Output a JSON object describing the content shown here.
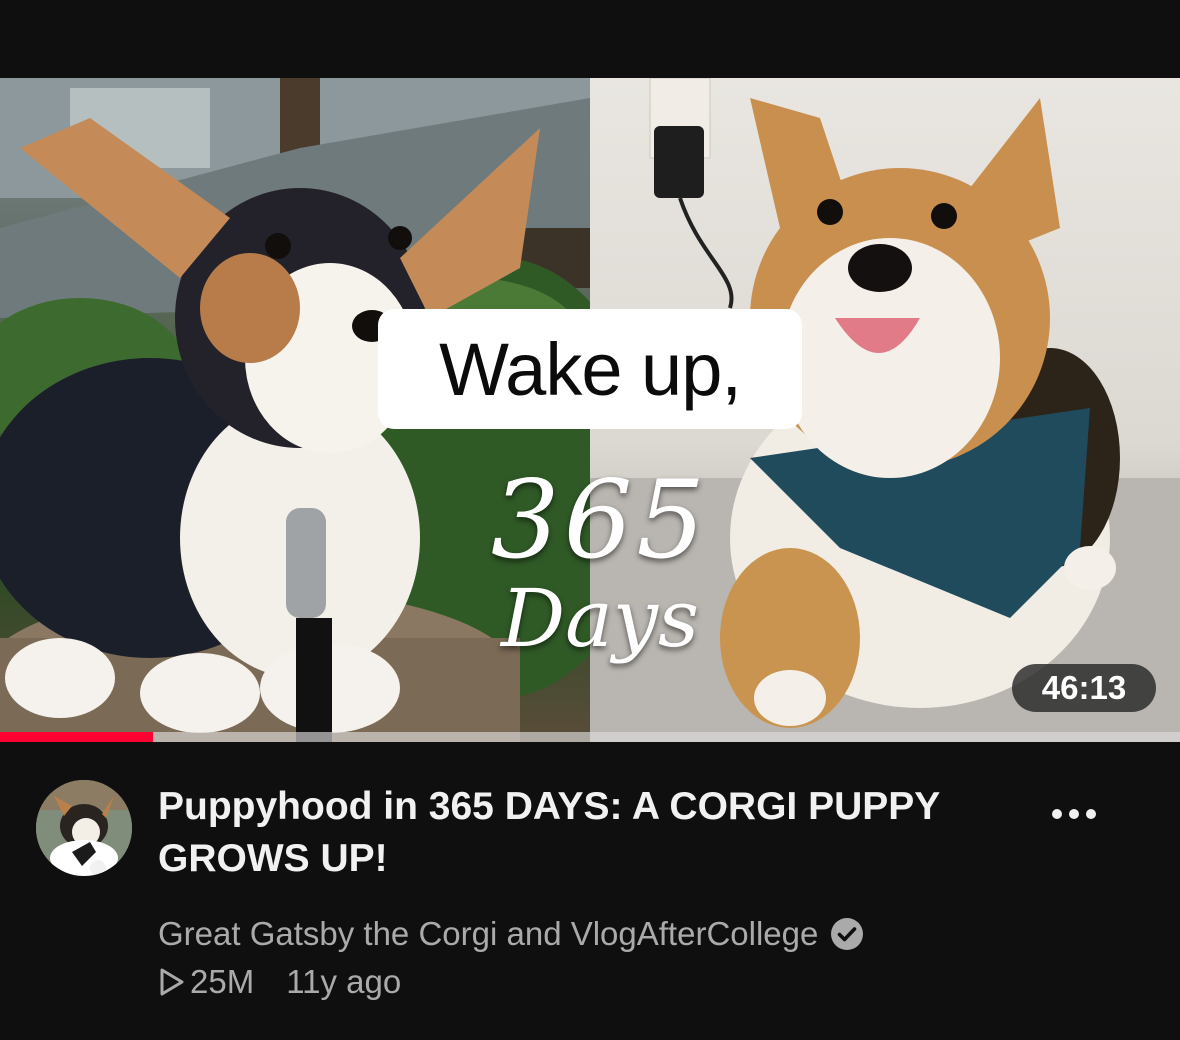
{
  "thumbnail": {
    "caption": "Wake up,",
    "overlay_number": "365",
    "overlay_word": "Days",
    "duration": "46:13",
    "watch_progress": 0.13
  },
  "video": {
    "title": "Puppyhood in 365 DAYS: A CORGI PUPPY GROWS UP!",
    "channel": "Great Gatsby the Corgi and VlogAfterCollege",
    "views": "25M",
    "age": "11y ago"
  },
  "icons": {
    "avatar": "corgi-avatar",
    "verified": "verified-check-icon",
    "views": "play-outline-icon",
    "more": "more-vert-icon"
  },
  "colors": {
    "background": "#0f0f0f",
    "progress": "#ff0033",
    "secondary_text": "#aaaaaa"
  }
}
